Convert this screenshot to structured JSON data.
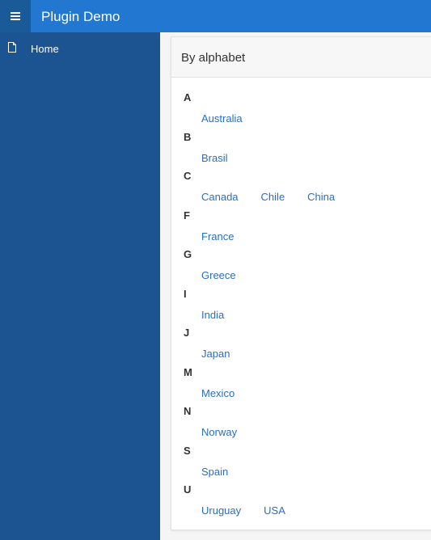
{
  "header": {
    "title": "Plugin Demo",
    "menu_icon": "hamburger-icon"
  },
  "sidebar": {
    "items": [
      {
        "label": "Home",
        "icon": "document-icon"
      }
    ]
  },
  "panel": {
    "title": "By alphabet",
    "groups": [
      {
        "letter": "A",
        "items": [
          "Australia"
        ]
      },
      {
        "letter": "B",
        "items": [
          "Brasil"
        ]
      },
      {
        "letter": "C",
        "items": [
          "Canada",
          "Chile",
          "China"
        ]
      },
      {
        "letter": "F",
        "items": [
          "France"
        ]
      },
      {
        "letter": "G",
        "items": [
          "Greece"
        ]
      },
      {
        "letter": "I",
        "items": [
          "India"
        ]
      },
      {
        "letter": "J",
        "items": [
          "Japan"
        ]
      },
      {
        "letter": "M",
        "items": [
          "Mexico"
        ]
      },
      {
        "letter": "N",
        "items": [
          "Norway"
        ]
      },
      {
        "letter": "S",
        "items": [
          "Spain"
        ]
      },
      {
        "letter": "U",
        "items": [
          "Uruguay",
          "USA"
        ]
      }
    ]
  },
  "colors": {
    "header": "#2277d0",
    "sidebar": "#1b5491",
    "link": "#2a6ec4"
  }
}
